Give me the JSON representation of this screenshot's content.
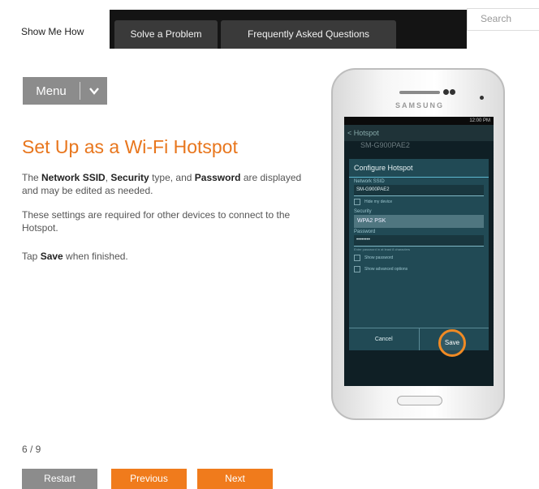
{
  "tabs": {
    "show_me_how": "Show Me How",
    "solve_problem": "Solve a Problem",
    "faq": "Frequently Asked Questions"
  },
  "search": {
    "placeholder": "Search"
  },
  "menu": {
    "label": "Menu"
  },
  "content": {
    "title": "Set Up as a Wi-Fi Hotspot",
    "p1_a": "The ",
    "p1_b": "Network SSID",
    "p1_c": ", ",
    "p1_d": "Security",
    "p1_e": " type, and ",
    "p1_f": "Password",
    "p1_g": " are displayed and may be edited as needed.",
    "p2": "These settings are required for other devices to connect to the Hotspot.",
    "p3_a": "Tap ",
    "p3_b": "Save",
    "p3_c": " when finished."
  },
  "pager": {
    "text": "6 / 9"
  },
  "nav": {
    "restart": "Restart",
    "previous": "Previous",
    "next": "Next"
  },
  "phone": {
    "brand": "SAMSUNG",
    "status_time": "12:00 PM",
    "action_title": "< Hotspot",
    "behind_item": "SM-G900PAE2",
    "dialog": {
      "title": "Configure Hotspot",
      "ssid_label": "Network SSID",
      "ssid_value": "SM-G900PAE2",
      "hide_device": "Hide my device",
      "security_label": "Security",
      "security_value": "WPA2 PSK",
      "password_label": "Password",
      "password_value": "••••••••",
      "password_hint": "Enter password in at least 8 characters",
      "show_password": "Show password",
      "advanced": "Show advanced options",
      "cancel": "Cancel",
      "save": "Save"
    }
  },
  "colors": {
    "accent": "#e8761d",
    "button_orange": "#f07b1c",
    "button_gray": "#8c8c8c"
  }
}
